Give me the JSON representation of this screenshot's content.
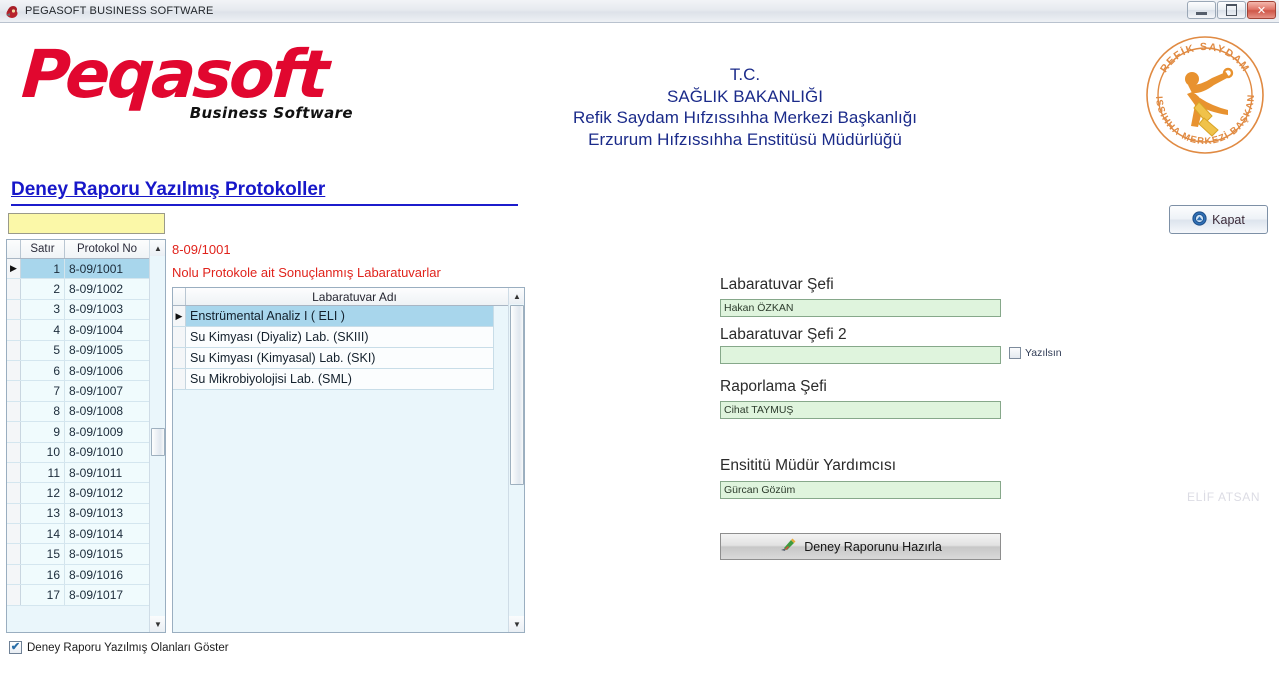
{
  "window": {
    "title": "PEGASOFT BUSINESS SOFTWARE",
    "icon": "app-icon",
    "minimize_label": "–",
    "maximize_label": "❐",
    "close_label": "✕"
  },
  "brand": {
    "name": "Peqasoft",
    "tagline": "Business Software",
    "color": "#e1072f"
  },
  "ministry": {
    "line1": "T.C.",
    "line2": "SAĞLIK BAKANLIĞI",
    "line3": "Refik Saydam Hıfzıssıhha Merkezi Başkanlığı",
    "line4": "Erzurum Hıfzıssıhha Enstitüsü Müdürlüğü",
    "color": "#1b2b8a"
  },
  "seal": {
    "top_text": "REFİK SAYDAM",
    "bottom_text": "HIFZISSIHHA MERKEZİ BAŞKANLIĞI",
    "color": "#e08a42"
  },
  "page": {
    "title": "Deney Raporu Yazılmış Protokoller",
    "title_color": "#1717c9"
  },
  "search": {
    "value": "",
    "placeholder": ""
  },
  "close_button": {
    "label": "Kapat",
    "icon": "close-circle-icon"
  },
  "protocol_grid": {
    "columns": [
      "Satır",
      "Protokol No"
    ],
    "selected_index": 0,
    "rows": [
      {
        "satir": "1",
        "protokol_no": "8-09/1001"
      },
      {
        "satir": "2",
        "protokol_no": "8-09/1002"
      },
      {
        "satir": "3",
        "protokol_no": "8-09/1003"
      },
      {
        "satir": "4",
        "protokol_no": "8-09/1004"
      },
      {
        "satir": "5",
        "protokol_no": "8-09/1005"
      },
      {
        "satir": "6",
        "protokol_no": "8-09/1006"
      },
      {
        "satir": "7",
        "protokol_no": "8-09/1007"
      },
      {
        "satir": "8",
        "protokol_no": "8-09/1008"
      },
      {
        "satir": "9",
        "protokol_no": "8-09/1009"
      },
      {
        "satir": "10",
        "protokol_no": "8-09/1010"
      },
      {
        "satir": "11",
        "protokol_no": "8-09/1011"
      },
      {
        "satir": "12",
        "protokol_no": "8-09/1012"
      },
      {
        "satir": "13",
        "protokol_no": "8-09/1013"
      },
      {
        "satir": "14",
        "protokol_no": "8-09/1014"
      },
      {
        "satir": "15",
        "protokol_no": "8-09/1015"
      },
      {
        "satir": "16",
        "protokol_no": "8-09/1016"
      },
      {
        "satir": "17",
        "protokol_no": "8-09/1017"
      }
    ]
  },
  "lab_panel": {
    "protocol_no": "8-09/1001",
    "description": "Nolu Protokole ait Sonuçlanmış Labaratuvarlar",
    "text_color": "#e0231c",
    "column_header": "Labaratuvar Adı",
    "selected_index": 0,
    "rows": [
      {
        "name": "Enstrümental Analiz I ( ELI )"
      },
      {
        "name": "Su Kimyası (Diyaliz) Lab. (SKIII)"
      },
      {
        "name": "Su Kimyası (Kimyasal) Lab. (SKI)"
      },
      {
        "name": "Su Mikrobiyolojisi Lab. (SML)"
      }
    ]
  },
  "form": {
    "lab_chief_label": "Labaratuvar Şefi",
    "lab_chief_value": "Hakan ÖZKAN",
    "lab_chief2_label": "Labaratuvar Şefi 2",
    "lab_chief2_value": "",
    "yazilsin_label": "Yazılsın",
    "yazilsin_checked": false,
    "reporting_chief_label": "Raporlama Şefi",
    "reporting_chief_value": "Cihat TAYMUŞ",
    "deputy_director_label": "Ensititü Müdür Yardımcısı",
    "deputy_director_value": "Gürcan Gözüm",
    "prepare_button_label": "Deney Raporunu Hazırla",
    "prepare_button_icon": "report-icon"
  },
  "watermark": {
    "text": "ELİF ATSAN"
  },
  "footer": {
    "checkbox_label": "Deney Raporu Yazılmış Olanları Göster",
    "checkbox_checked": true,
    "check_glyph": "✔"
  }
}
